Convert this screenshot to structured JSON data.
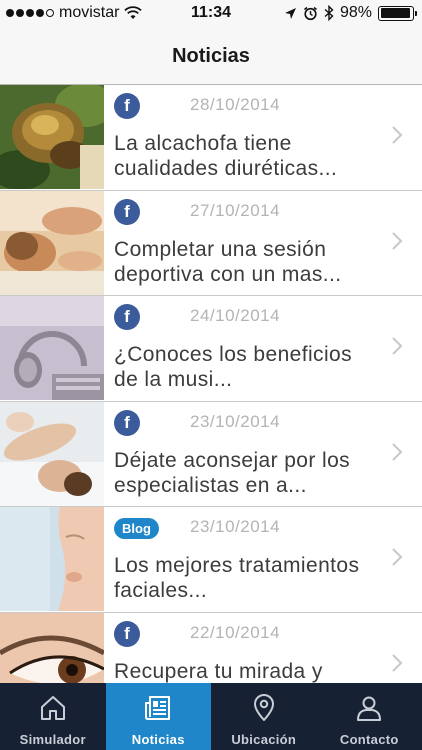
{
  "status_bar": {
    "carrier": "movistar",
    "time": "11:34",
    "battery": "98%",
    "battery_level": 0.98,
    "signal_dots": 4
  },
  "nav": {
    "title": "Noticias"
  },
  "news": [
    {
      "source": "facebook",
      "badge": "f",
      "date": "28/10/2014",
      "title": "La alcachofa tiene cualidades diuréticas..."
    },
    {
      "source": "facebook",
      "badge": "f",
      "date": "27/10/2014",
      "title": "Completar una sesión deportiva con un mas..."
    },
    {
      "source": "facebook",
      "badge": "f",
      "date": "24/10/2014",
      "title": "¿Conoces los beneficios de la musi..."
    },
    {
      "source": "facebook",
      "badge": "f",
      "date": "23/10/2014",
      "title": "Déjate aconsejar por los especialistas en a..."
    },
    {
      "source": "blog",
      "badge": "Blog",
      "date": "23/10/2014",
      "title": "Los mejores tratamientos faciales..."
    },
    {
      "source": "facebook",
      "badge": "f",
      "date": "22/10/2014",
      "title": "Recupera tu mirada y"
    }
  ],
  "tabs": [
    {
      "label": "Simulador",
      "icon": "home-icon",
      "active": false
    },
    {
      "label": "Noticias",
      "icon": "newspaper-icon",
      "active": true
    },
    {
      "label": "Ubicación",
      "icon": "location-pin-icon",
      "active": false
    },
    {
      "label": "Contacto",
      "icon": "person-icon",
      "active": false
    }
  ],
  "colors": {
    "facebook_blue": "#3b5b9b",
    "blog_blue": "#1f86c9",
    "tab_active": "#1f86c9",
    "tab_bar_bg": "#162233"
  }
}
